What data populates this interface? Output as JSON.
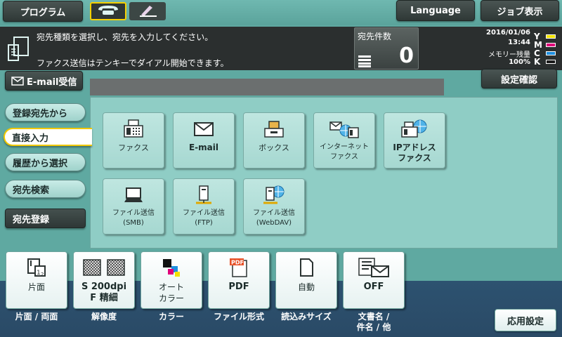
{
  "header": {
    "program_label": "プログラム",
    "language_label": "Language",
    "job_display_label": "ジョブ表示",
    "modes": [
      {
        "name": "fax-mode",
        "icon": "telephone-icon",
        "selected": true
      },
      {
        "name": "scan-mode",
        "icon": "pen-icon",
        "selected": false
      }
    ]
  },
  "message": {
    "line1": "宛先種類を選択し、宛先を入力してください。",
    "line2": "ファクス送信はテンキーでダイアル開始できます。",
    "dest_count_label": "宛先件数",
    "dest_count_value": "0"
  },
  "status": {
    "date": "2016/01/06",
    "time": "13:44",
    "memory_label": "メモリー残量",
    "memory_value": "100%",
    "inks": [
      {
        "letter": "Y",
        "color": "#f2e200"
      },
      {
        "letter": "M",
        "color": "#e0007a"
      },
      {
        "letter": "C",
        "color": "#1e8fe0"
      },
      {
        "letter": "K",
        "color": "#1a1a1a"
      }
    ]
  },
  "email_receive_label": "E-mail受信",
  "settings_check_label": "設定確認",
  "sidebar": {
    "items": [
      {
        "label": "登録宛先から"
      },
      {
        "label": "直接入力"
      },
      {
        "label": "履歴から選択"
      },
      {
        "label": "宛先検索"
      },
      {
        "label": "宛先登録"
      }
    ]
  },
  "tiles": [
    {
      "label": "ファクス",
      "icon": "fax-icon"
    },
    {
      "label": "E-mail",
      "icon": "envelope-icon"
    },
    {
      "label": "ボックス",
      "icon": "box-icon"
    },
    {
      "label": "インターネット\nファクス",
      "icon": "internet-fax-icon"
    },
    {
      "label": "IPアドレス\nファクス",
      "icon": "ip-fax-icon"
    },
    {
      "label": "ファイル送信\n(SMB)",
      "icon": "computer-icon"
    },
    {
      "label": "ファイル送信\n(FTP)",
      "icon": "server-icon"
    },
    {
      "label": "ファイル送信\n(WebDAV)",
      "icon": "webdav-server-icon"
    }
  ],
  "settings": [
    {
      "value": "片面",
      "label": "片面 / 両面",
      "icon": "simplex-icon"
    },
    {
      "value": "S 200dpi\nF 精細",
      "label": "解像度",
      "icon": "resolution-icon"
    },
    {
      "value": "オート\nカラー",
      "label": "カラー",
      "icon": "color-icon"
    },
    {
      "value": "PDF",
      "label": "ファイル形式",
      "icon": "pdf-icon"
    },
    {
      "value": "自動",
      "label": "読込みサイズ",
      "icon": "page-size-icon"
    },
    {
      "value": "OFF",
      "label": "文書名 /\n件名 / 他",
      "icon": "document-mail-icon"
    }
  ],
  "application_settings_label": "応用設定"
}
